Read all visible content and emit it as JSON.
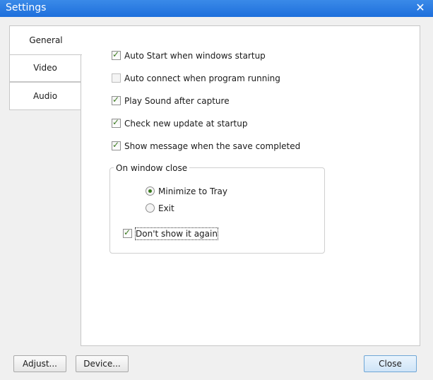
{
  "window": {
    "title": "Settings",
    "close_glyph": "✕"
  },
  "tabs": [
    {
      "label": "General",
      "active": true
    },
    {
      "label": "Video",
      "active": false
    },
    {
      "label": "Audio",
      "active": false
    }
  ],
  "general": {
    "options": [
      {
        "label": "Auto Start when windows startup",
        "checked": true
      },
      {
        "label": "Auto connect when program running",
        "checked": false
      },
      {
        "label": "Play Sound after capture",
        "checked": true
      },
      {
        "label": "Check new update at startup",
        "checked": true
      },
      {
        "label": "Show message when the save completed",
        "checked": true
      }
    ],
    "on_close": {
      "title": "On window close",
      "radios": [
        {
          "label": "Minimize to Tray",
          "selected": true
        },
        {
          "label": "Exit",
          "selected": false
        }
      ],
      "dont_show": {
        "label": "Don't show it again",
        "checked": true
      }
    }
  },
  "buttons": {
    "adjust": "Adjust...",
    "device": "Device...",
    "close": "Close"
  },
  "icons": {
    "check": "✓"
  }
}
